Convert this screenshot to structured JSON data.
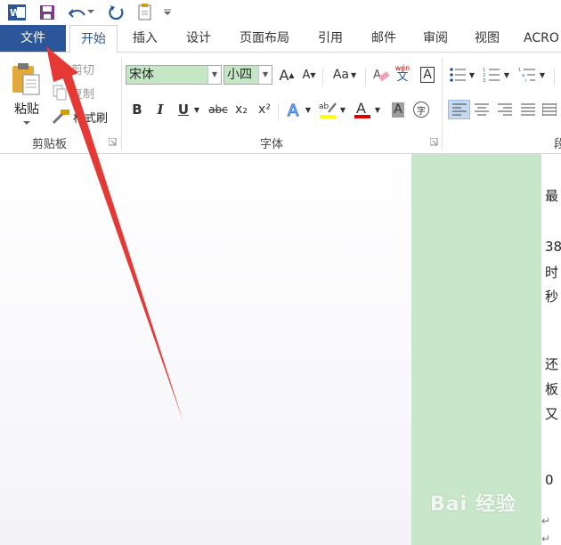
{
  "tabs": {
    "file": "文件",
    "home": "开始",
    "insert": "插入",
    "design": "设计",
    "layout": "页面布局",
    "references": "引用",
    "mailings": "邮件",
    "review": "审阅",
    "view": "视图",
    "acrobat": "ACRO"
  },
  "clipboard": {
    "paste": "粘贴",
    "cut": "剪切",
    "copy": "复制",
    "format_painter": "格式刷",
    "group_label": "剪贴板"
  },
  "font": {
    "name": "宋体",
    "size": "小四",
    "group_label": "字体",
    "bold": "B",
    "italic": "I",
    "underline": "U",
    "strike": "abc",
    "subscript": "x₂",
    "superscript": "x²",
    "grow": "A",
    "shrink": "A",
    "change_case": "Aa",
    "phonetic": "wén",
    "phonetic_char": "文",
    "char_border": "A",
    "font_color": "A",
    "char_shading": "A",
    "enclose": "字"
  },
  "paragraph": {
    "group_label_partial": "段"
  },
  "document": {
    "lines": [
      "最",
      "38",
      "时",
      "秒",
      "还",
      "板",
      "又",
      "0 "
    ],
    "para_mark": "↵"
  },
  "watermark": "Bai 经验",
  "colors": {
    "file_tab": "#2b579a",
    "page_fill": "#c8e6c9",
    "arrow": "#e53935",
    "font_color_bar": "#e00000",
    "highlight_bar": "#ffff00"
  }
}
